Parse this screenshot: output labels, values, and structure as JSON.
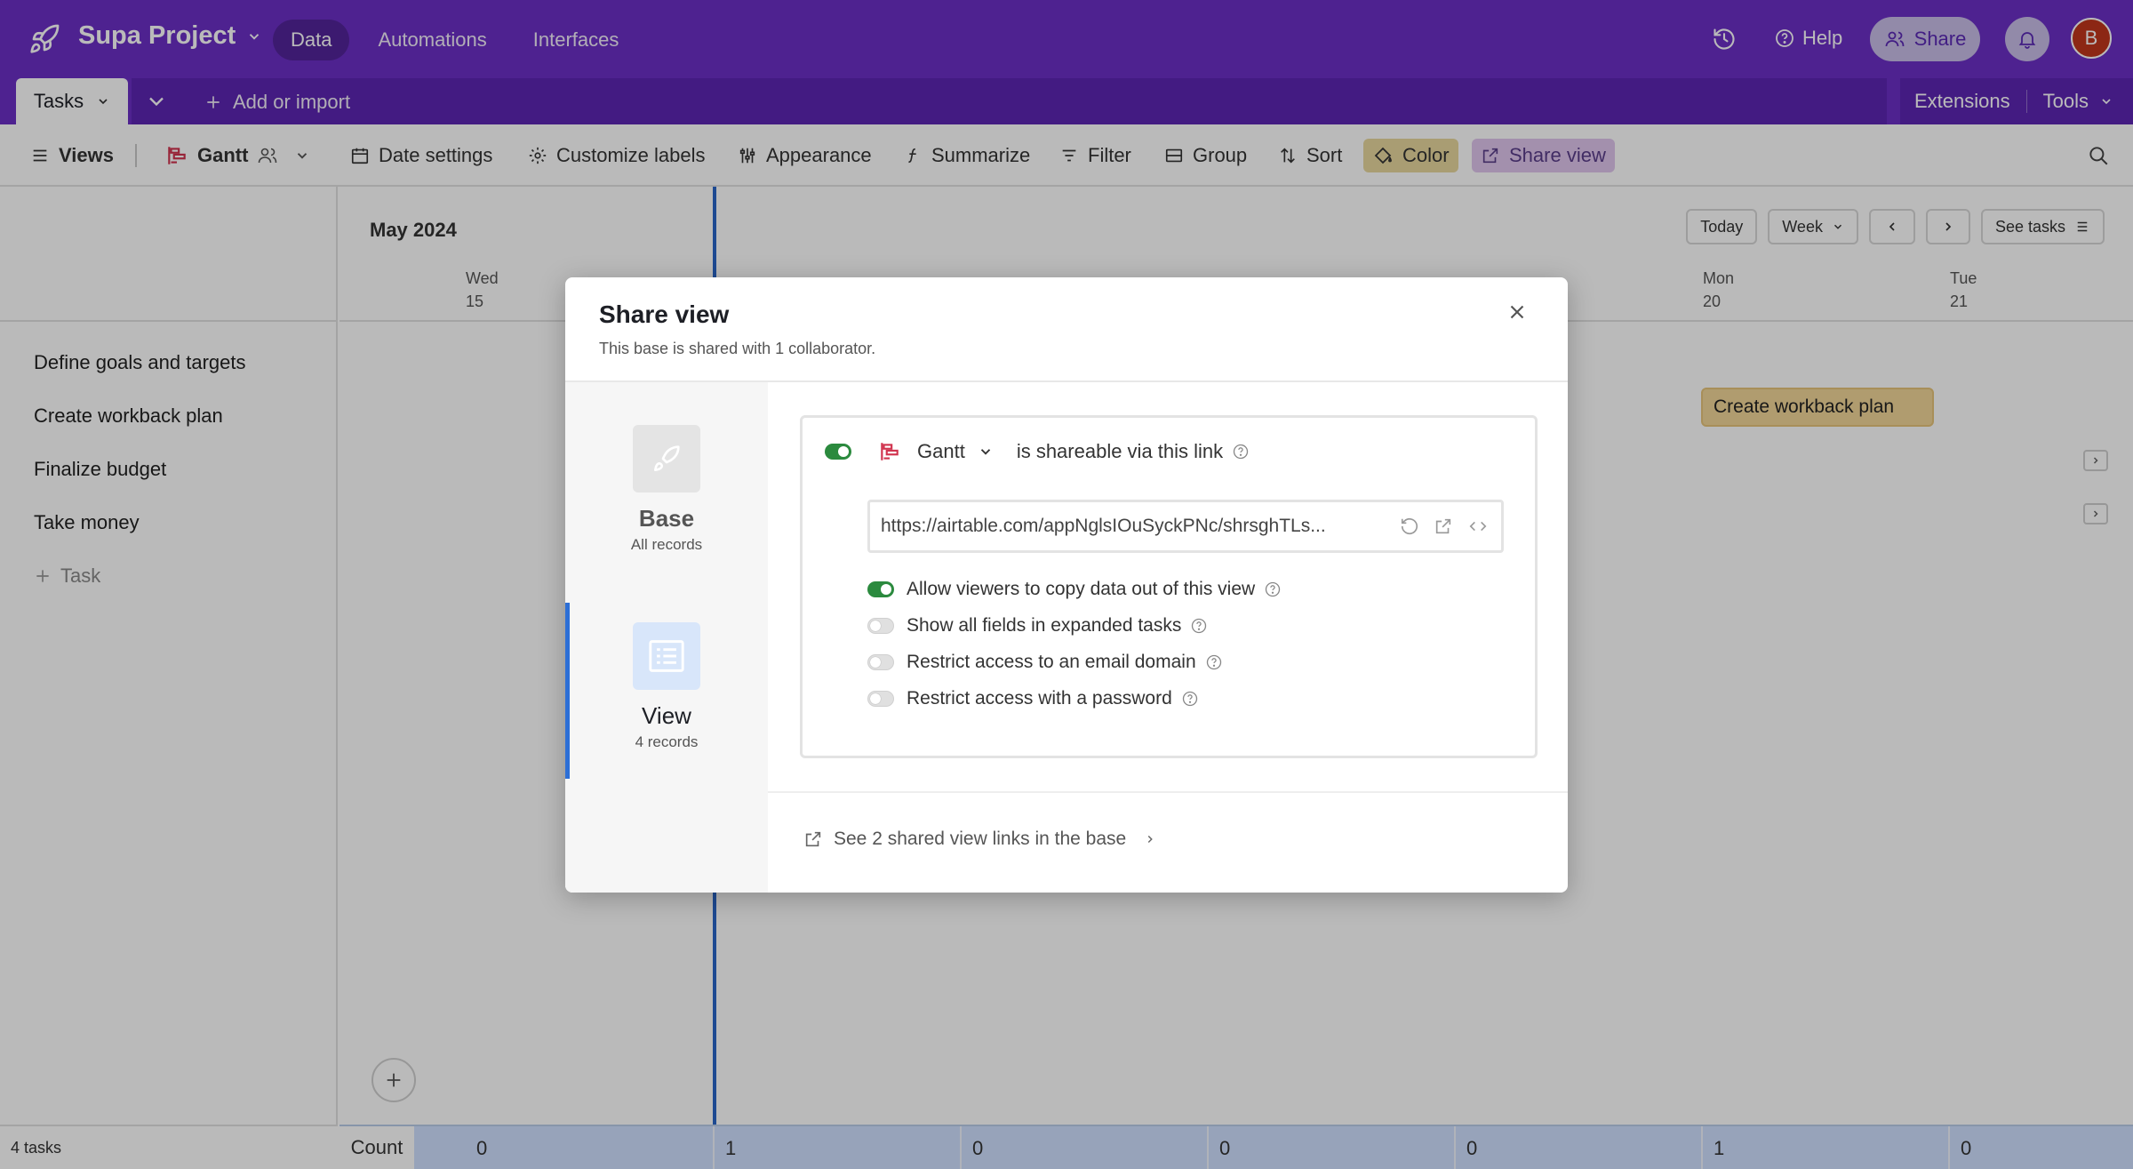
{
  "topbar": {
    "project_name": "Supa Project",
    "nav": [
      "Data",
      "Automations",
      "Interfaces"
    ],
    "help_label": "Help",
    "share_label": "Share",
    "avatar_initial": "B",
    "bg_color": "#6b2fc6"
  },
  "tabs": {
    "active_tab": "Tasks",
    "add_import_label": "Add or import",
    "extensions_label": "Extensions",
    "tools_label": "Tools"
  },
  "viewbar": {
    "views_label": "Views",
    "view_name": "Gantt",
    "date_settings": "Date settings",
    "customize_labels": "Customize labels",
    "appearance": "Appearance",
    "summarize": "Summarize",
    "filter": "Filter",
    "group": "Group",
    "sort": "Sort",
    "color": "Color",
    "share_view": "Share view"
  },
  "tasks": [
    "Define goals and targets",
    "Create workback plan",
    "Finalize budget",
    "Take money"
  ],
  "add_task_label": "Task",
  "timeline": {
    "month": "May 2024",
    "today_label": "Today",
    "scale_label": "Week",
    "see_tasks_label": "See tasks",
    "days": [
      {
        "name": "Wed",
        "num": "15"
      },
      {
        "name": "Mon",
        "num": "20"
      },
      {
        "name": "Tue",
        "num": "21"
      }
    ],
    "gantt_bar_label": "Create workback plan"
  },
  "footer": {
    "task_count": "4 tasks",
    "count_label": "Count",
    "counts": [
      "0",
      "1",
      "0",
      "0",
      "0",
      "1",
      "0"
    ]
  },
  "modal": {
    "title": "Share view",
    "subtitle": "This base is shared with 1 collaborator.",
    "side": {
      "base_label": "Base",
      "base_sub": "All records",
      "view_label": "View",
      "view_sub": "4 records"
    },
    "view_name": "Gantt",
    "shareable_text": "is shareable via this link",
    "shareable_enabled": true,
    "url": "https://airtable.com/appNglsIOuSyckPNc/shrsghTLs...",
    "options": [
      {
        "label": "Allow viewers to copy data out of this view",
        "enabled": true
      },
      {
        "label": "Show all fields in expanded tasks",
        "enabled": false
      },
      {
        "label": "Restrict access to an email domain",
        "enabled": false
      },
      {
        "label": "Restrict access with a password",
        "enabled": false
      }
    ],
    "footer_link": "See 2 shared view links in the base"
  }
}
